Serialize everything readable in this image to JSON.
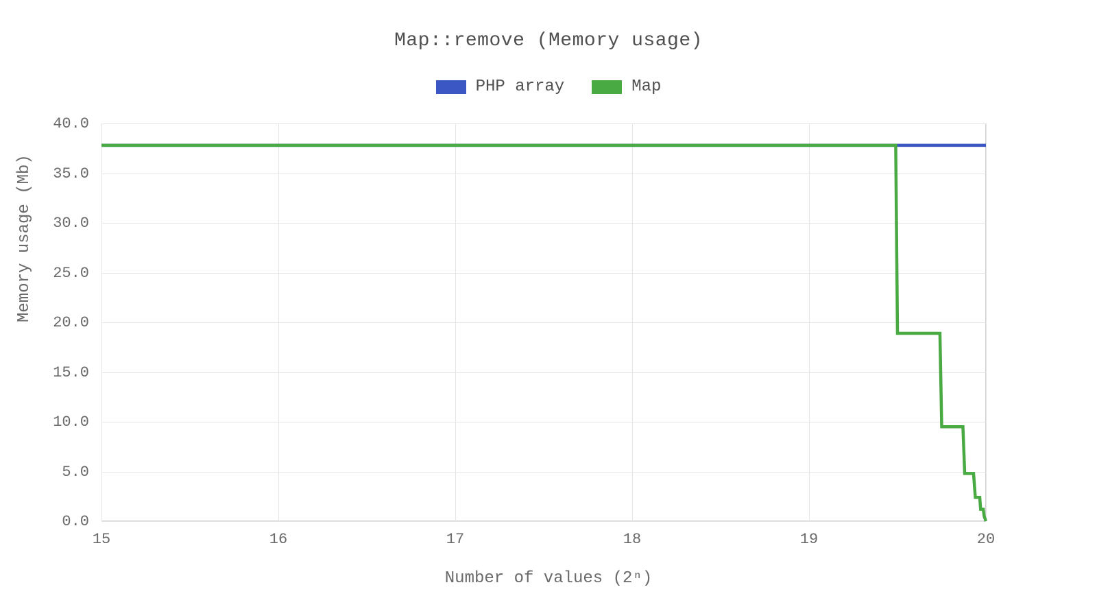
{
  "chart_data": {
    "type": "line",
    "title": "Map::remove (Memory usage)",
    "xlabel": "Number of values (2ⁿ)",
    "ylabel": "Memory usage (Mb)",
    "xlim": [
      15,
      20
    ],
    "ylim": [
      0,
      40
    ],
    "x_ticks": [
      15,
      16,
      17,
      18,
      19,
      20
    ],
    "y_ticks": [
      0.0,
      5.0,
      10.0,
      15.0,
      20.0,
      25.0,
      30.0,
      35.0,
      40.0
    ],
    "x_tick_labels": [
      "15",
      "16",
      "17",
      "18",
      "19",
      "20"
    ],
    "y_tick_labels": [
      "0.0",
      "5.0",
      "10.0",
      "15.0",
      "20.0",
      "25.0",
      "30.0",
      "35.0",
      "40.0"
    ],
    "legend": {
      "position": "top-center",
      "items": [
        "PHP array",
        "Map"
      ]
    },
    "grid": true,
    "series": [
      {
        "name": "PHP array",
        "color": "#3a57c4",
        "x": [
          15.0,
          20.0
        ],
        "values": [
          37.8,
          37.8
        ]
      },
      {
        "name": "Map",
        "color": "#49a942",
        "x": [
          15.0,
          19.49,
          19.5,
          19.74,
          19.75,
          19.87,
          19.88,
          19.93,
          19.94,
          19.965,
          19.97,
          19.985,
          19.99,
          20.0
        ],
        "values": [
          37.8,
          37.8,
          18.9,
          18.9,
          9.5,
          9.5,
          4.8,
          4.8,
          2.4,
          2.4,
          1.2,
          1.2,
          0.5,
          0.0
        ]
      }
    ]
  },
  "colors": {
    "php_array": "#3a57c4",
    "map": "#49a942",
    "grid": "#e5e5e5",
    "axis": "#d0d0d0",
    "text": "#505050"
  }
}
